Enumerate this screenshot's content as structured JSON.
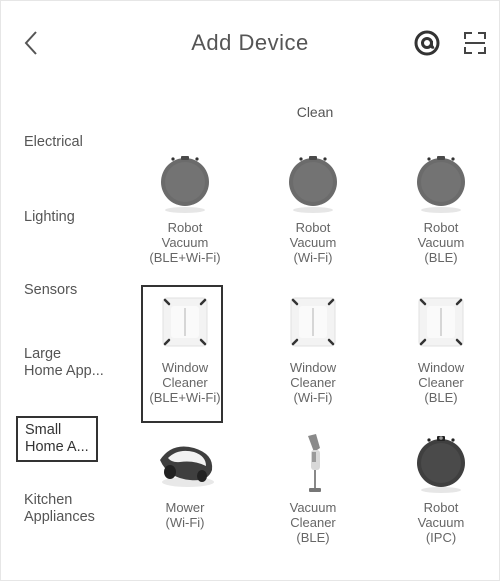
{
  "header": {
    "title": "Add Device",
    "back_icon": "chevron-left-icon",
    "at_icon": "at-sign-icon",
    "scan_icon": "scan-icon"
  },
  "sidebar": {
    "items": [
      {
        "lines": [
          "Electrical"
        ]
      },
      {
        "lines": [
          "Lighting"
        ]
      },
      {
        "lines": [
          "Sensors"
        ]
      },
      {
        "lines": [
          "Large",
          "Home App..."
        ]
      },
      {
        "lines": [
          "Small",
          "Home A..."
        ],
        "selected": true
      },
      {
        "lines": [
          "Kitchen",
          "Appliances"
        ]
      }
    ]
  },
  "section": {
    "title": "Clean"
  },
  "devices": [
    {
      "icon": "robot-vacuum-icon",
      "lines": [
        "Robot",
        "Vacuum",
        "(BLE+Wi-Fi)"
      ]
    },
    {
      "icon": "robot-vacuum-icon",
      "lines": [
        "Robot",
        "Vacuum",
        "(Wi-Fi)"
      ]
    },
    {
      "icon": "robot-vacuum-icon",
      "lines": [
        "Robot",
        "Vacuum",
        "(BLE)"
      ]
    },
    {
      "icon": "window-cleaner-icon",
      "lines": [
        "Window",
        "Cleaner",
        "(BLE+Wi-Fi)"
      ],
      "selected": true
    },
    {
      "icon": "window-cleaner-icon",
      "lines": [
        "Window",
        "Cleaner",
        "(Wi-Fi)"
      ]
    },
    {
      "icon": "window-cleaner-icon",
      "lines": [
        "Window",
        "Cleaner",
        "(BLE)"
      ]
    },
    {
      "icon": "mower-icon",
      "lines": [
        "Mower",
        "(Wi-Fi)"
      ]
    },
    {
      "icon": "handheld-vacuum-icon",
      "lines": [
        "Vacuum",
        "Cleaner",
        "(BLE)"
      ]
    },
    {
      "icon": "robot-vacuum-ipc-icon",
      "lines": [
        "Robot",
        "Vacuum",
        "(IPC)"
      ]
    }
  ],
  "colors": {
    "icon_gray": "#6b6b6b",
    "icon_dark": "#3f3f3f",
    "text": "#555555",
    "selection_border": "#333333"
  }
}
